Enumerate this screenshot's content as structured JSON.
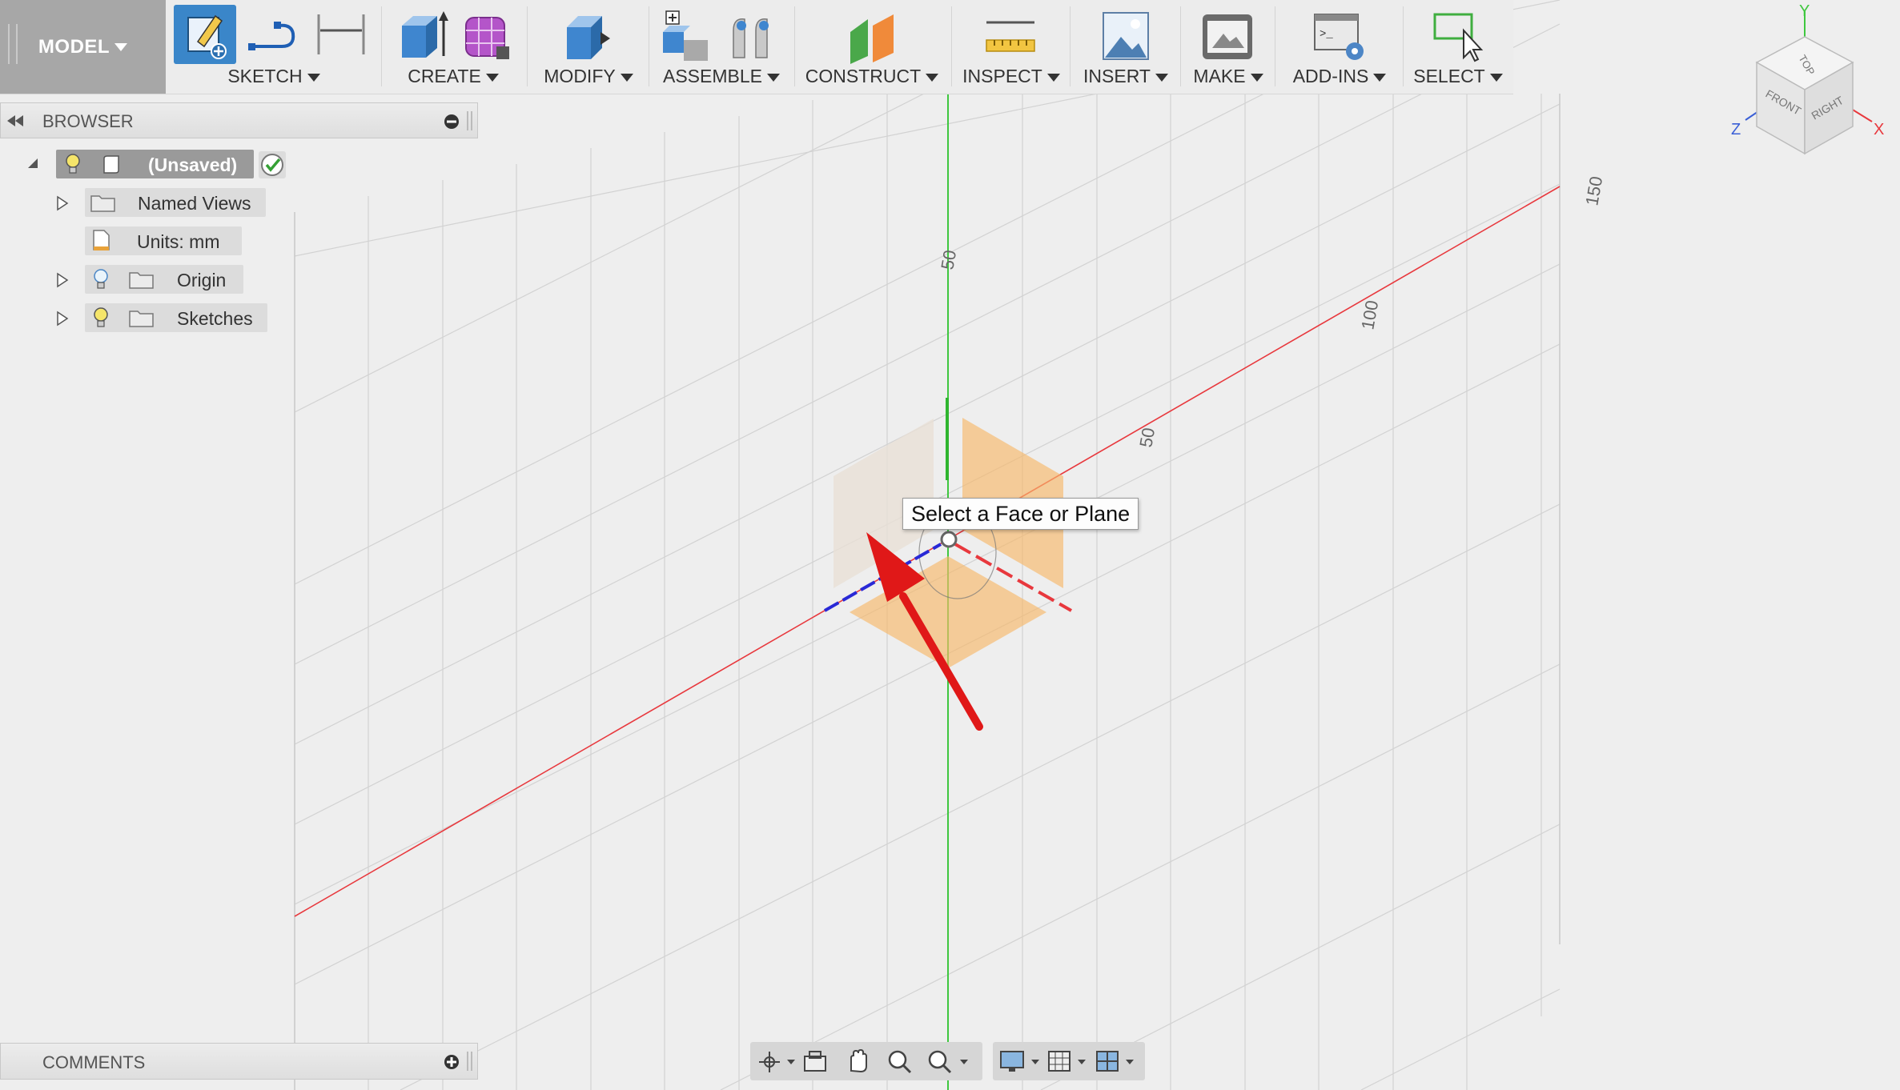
{
  "toolbar": {
    "model_label": "MODEL",
    "groups": [
      {
        "label": "SKETCH"
      },
      {
        "label": "CREATE"
      },
      {
        "label": "MODIFY"
      },
      {
        "label": "ASSEMBLE"
      },
      {
        "label": "CONSTRUCT"
      },
      {
        "label": "INSPECT"
      },
      {
        "label": "INSERT"
      },
      {
        "label": "MAKE"
      },
      {
        "label": "ADD-INS"
      },
      {
        "label": "SELECT"
      }
    ]
  },
  "browser": {
    "title": "BROWSER",
    "items": [
      {
        "label": "(Unsaved)"
      },
      {
        "label": "Named Views"
      },
      {
        "label": "Units: mm"
      },
      {
        "label": "Origin"
      },
      {
        "label": "Sketches"
      }
    ]
  },
  "comments": {
    "title": "COMMENTS"
  },
  "tooltip": {
    "text": "Select a Face or Plane"
  },
  "viewport": {
    "axis_labels": {
      "y_50": "50",
      "x_50": "50",
      "x_100": "100",
      "x_150": "150"
    }
  },
  "viewcube": {
    "faces": {
      "top": "TOP",
      "front": "FRONT",
      "right": "RIGHT"
    },
    "axes": {
      "x": "X",
      "y": "Y",
      "z": "Z"
    }
  },
  "colors": {
    "x_axis": "#e8383d",
    "y_axis": "#3fc73f",
    "z_axis": "#2929d6",
    "plane": "#f7b86a",
    "arrow": "#e01818",
    "sketch_active": "#3a86c9"
  }
}
